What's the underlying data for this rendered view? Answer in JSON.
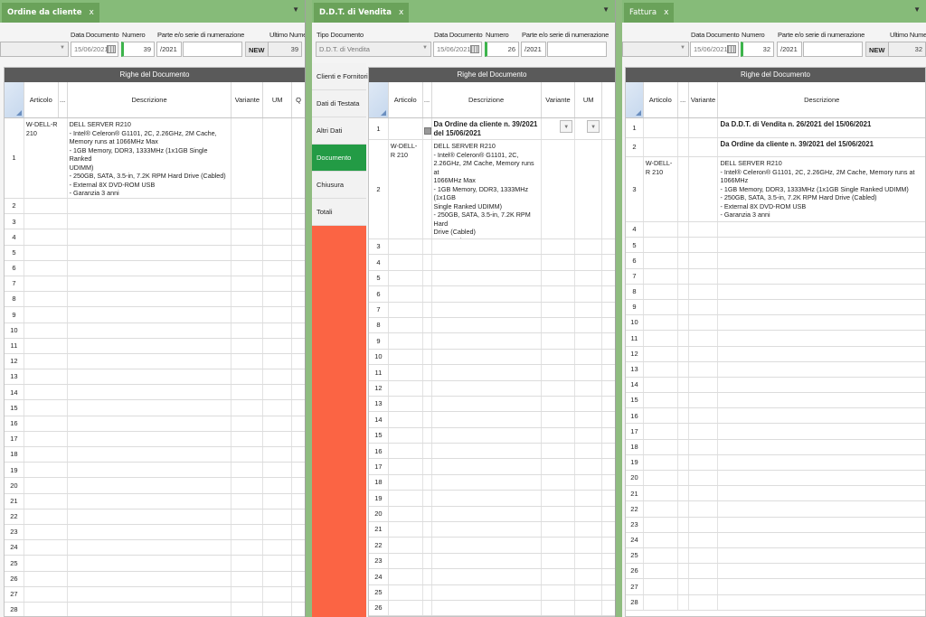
{
  "win1": {
    "tab": "Ordine da cliente",
    "labels": {
      "data": "Data Documento",
      "numero": "Numero",
      "parte": "Parte e/o serie di numerazione",
      "ultimo": "Ultimo Numer"
    },
    "fields": {
      "data": "15/06/2021",
      "numero": "39",
      "serie": "/2021",
      "ultimo": "39"
    },
    "new_label": "NEW",
    "grid_title": "Righe del Documento",
    "headers": {
      "articolo": "Articolo",
      "dots": "...",
      "descrizione": "Descrizione",
      "variante": "Variante",
      "um": "UM",
      "q": "Q"
    },
    "rows": [
      {
        "n": "1",
        "articolo": "W-DELL-R 210",
        "descrizione": "DELL SERVER R210\n- Intel® Celeron® G1101, 2C, 2.26GHz, 2M Cache,\nMemory runs at 1066MHz Max\n- 1GB Memory, DDR3, 1333MHz (1x1GB Single Ranked\nUDIMM)\n- 250GB, SATA, 3.5-in, 7.2K RPM Hard Drive (Cabled)\n- External 8X DVD-ROM USB\n- Garanzia 3 anni"
      },
      {
        "n": "2"
      },
      {
        "n": "3"
      },
      {
        "n": "4"
      },
      {
        "n": "5"
      },
      {
        "n": "6"
      },
      {
        "n": "7"
      },
      {
        "n": "8"
      },
      {
        "n": "9"
      },
      {
        "n": "10"
      },
      {
        "n": "11"
      },
      {
        "n": "12"
      },
      {
        "n": "13"
      },
      {
        "n": "14"
      },
      {
        "n": "15"
      },
      {
        "n": "16"
      },
      {
        "n": "17"
      },
      {
        "n": "18"
      },
      {
        "n": "19"
      },
      {
        "n": "20"
      },
      {
        "n": "21"
      },
      {
        "n": "22"
      },
      {
        "n": "23"
      },
      {
        "n": "24"
      },
      {
        "n": "25"
      },
      {
        "n": "26"
      },
      {
        "n": "27"
      },
      {
        "n": "28"
      }
    ]
  },
  "win2": {
    "tab": "D.D.T. di Vendita",
    "labels": {
      "tipo": "Tipo Documento",
      "data": "Data Documento",
      "numero": "Numero",
      "parte": "Parte e/o serie di numerazione"
    },
    "fields": {
      "tipo": "D.D.T. di Vendita",
      "data": "15/06/2021",
      "numero": "26",
      "serie": "/2021"
    },
    "sidebar": [
      {
        "label": "Clienti e Fornitori"
      },
      {
        "label": "Dati di Testata"
      },
      {
        "label": "Altri Dati"
      },
      {
        "label": "Documento",
        "active": true
      },
      {
        "label": "Chiusura"
      },
      {
        "label": "Totali"
      }
    ],
    "grid_title": "Righe del Documento",
    "headers": {
      "articolo": "Articolo",
      "dots": "...",
      "descrizione": "Descrizione",
      "variante": "Variante",
      "um": "UM"
    },
    "rows": [
      {
        "n": "1",
        "descrizione": "Da Ordine da cliente n. 39/2021\ndel 15/06/2021",
        "bold": true,
        "dropdowns": true
      },
      {
        "n": "2",
        "articolo": "W-DELL-R 210",
        "descrizione": "DELL SERVER R210\n- Intel® Celeron® G1101, 2C,\n2.26GHz, 2M Cache, Memory runs at\n1066MHz Max\n- 1GB Memory, DDR3, 1333MHz (1x1GB\nSingle Ranked UDIMM)\n- 250GB, SATA, 3.5-in, 7.2K RPM Hard\nDrive (Cabled)\n- External 8X DVD-ROM USB\n- Garanzia 3 anni"
      },
      {
        "n": "3"
      },
      {
        "n": "4"
      },
      {
        "n": "5"
      },
      {
        "n": "6"
      },
      {
        "n": "7"
      },
      {
        "n": "8"
      },
      {
        "n": "9"
      },
      {
        "n": "10"
      },
      {
        "n": "11"
      },
      {
        "n": "12"
      },
      {
        "n": "13"
      },
      {
        "n": "14"
      },
      {
        "n": "15"
      },
      {
        "n": "16"
      },
      {
        "n": "17"
      },
      {
        "n": "18"
      },
      {
        "n": "19"
      },
      {
        "n": "20"
      },
      {
        "n": "21"
      },
      {
        "n": "22"
      },
      {
        "n": "23"
      },
      {
        "n": "24"
      },
      {
        "n": "25"
      },
      {
        "n": "26"
      }
    ]
  },
  "win3": {
    "tab": "Fattura",
    "labels": {
      "data": "Data Documento",
      "numero": "Numero",
      "parte": "Parte e/o serie di numerazione",
      "ultimo": "Ultimo Numer"
    },
    "fields": {
      "data": "15/06/2021",
      "numero": "32",
      "serie": "/2021",
      "ultimo": "32"
    },
    "new_label": "NEW",
    "grid_title": "Righe del Documento",
    "headers": {
      "articolo": "Articolo",
      "dots": "...",
      "variante": "Variante",
      "descrizione": "Descrizione"
    },
    "rows": [
      {
        "n": "1",
        "descrizione": "Da D.D.T. di Vendita n. 26/2021 del 15/06/2021",
        "bold": true
      },
      {
        "n": "2",
        "descrizione": "Da Ordine da cliente n. 39/2021 del 15/06/2021",
        "bold": true
      },
      {
        "n": "3",
        "articolo": "W-DELL-R 210",
        "descrizione": "DELL SERVER R210\n- Intel® Celeron® G1101, 2C, 2.26GHz, 2M Cache, Memory runs at 1066MHz\n- 1GB Memory, DDR3, 1333MHz (1x1GB Single Ranked UDIMM)\n- 250GB, SATA, 3.5-in, 7.2K RPM Hard Drive (Cabled)\n- External 8X DVD-ROM USB\n- Garanzia 3 anni"
      },
      {
        "n": "4"
      },
      {
        "n": "5"
      },
      {
        "n": "6"
      },
      {
        "n": "7"
      },
      {
        "n": "8"
      },
      {
        "n": "9"
      },
      {
        "n": "10"
      },
      {
        "n": "11"
      },
      {
        "n": "12"
      },
      {
        "n": "13"
      },
      {
        "n": "14"
      },
      {
        "n": "15"
      },
      {
        "n": "16"
      },
      {
        "n": "17"
      },
      {
        "n": "18"
      },
      {
        "n": "19"
      },
      {
        "n": "20"
      },
      {
        "n": "21"
      },
      {
        "n": "22"
      },
      {
        "n": "23"
      },
      {
        "n": "24"
      },
      {
        "n": "25"
      },
      {
        "n": "26"
      },
      {
        "n": "27"
      },
      {
        "n": "28"
      }
    ]
  }
}
